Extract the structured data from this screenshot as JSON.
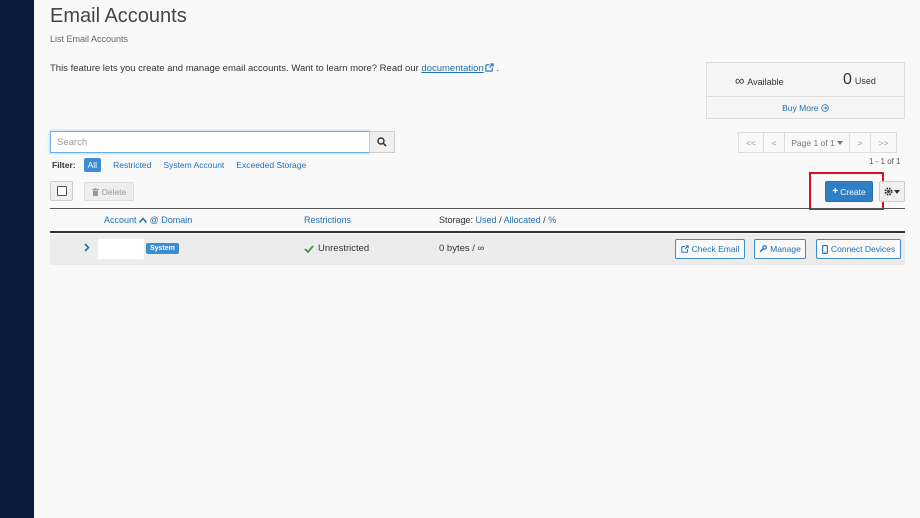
{
  "header": {
    "title": "Email Accounts",
    "subtitle": "List Email Accounts"
  },
  "intro": {
    "text": "This feature lets you create and manage email accounts. Want to learn more? Read our",
    "link_label": "documentation",
    "suffix": "."
  },
  "stats": {
    "available_value": "∞",
    "available_label": "Available",
    "used_value": "0",
    "used_label": "Used",
    "buy_more_label": "Buy More"
  },
  "search": {
    "placeholder": "Search",
    "value": ""
  },
  "filter": {
    "label": "Filter:",
    "options": [
      "All",
      "Restricted",
      "System Account",
      "Exceeded Storage"
    ],
    "active": "All"
  },
  "pagination": {
    "first": "<<",
    "prev": "<",
    "page_label": "Page 1 of 1",
    "next": ">",
    "last": ">>",
    "count": "1 - 1 of 1"
  },
  "toolbar": {
    "delete_label": "Delete",
    "create_label": "Create"
  },
  "table": {
    "headers": {
      "account": "Account",
      "at_domain": "@ Domain",
      "restrictions": "Restrictions",
      "storage_prefix": "Storage:",
      "used": "Used",
      "slash1": "/",
      "allocated": "Allocated",
      "slash2": "/",
      "percent": "%"
    },
    "rows": [
      {
        "badge": "System",
        "restriction": "Unrestricted",
        "storage": "0 bytes / ∞",
        "actions": [
          "Check Email",
          "Manage",
          "Connect Devices"
        ]
      }
    ]
  },
  "colors": {
    "sidebar": "#0e1c3d",
    "accent": "#2f7fc7",
    "highlight": "#d9121f",
    "success": "#3c9a3c"
  }
}
